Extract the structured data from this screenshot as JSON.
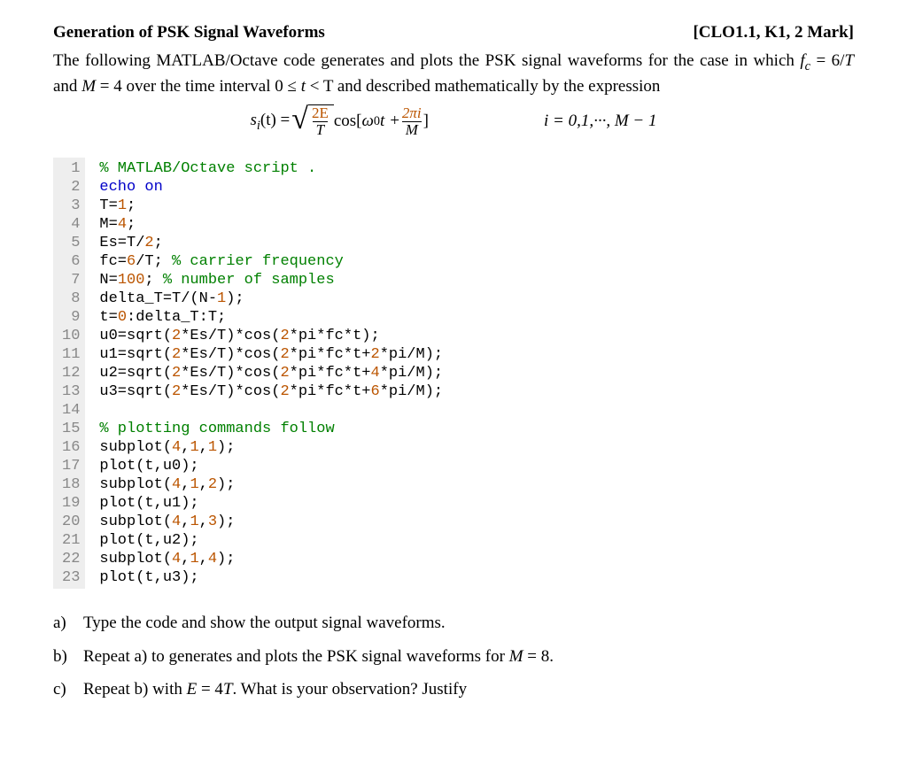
{
  "header": {
    "title": "Generation of PSK Signal Waveforms",
    "tag": "[CLO1.1, K1, 2 Mark]"
  },
  "intro": {
    "t1": "The following MATLAB/Octave code generates and plots the PSK signal waveforms for the case in which ",
    "fc": "f",
    "fc_sub": "c",
    "t2": " = 6/",
    "T": "T",
    "t3": " and ",
    "M": "M",
    "t4": " = 4 over the time interval 0 ≤ ",
    "t": "t",
    "t5": " < T and described mathematically by the expression"
  },
  "equation": {
    "lhs_s": "s",
    "lhs_i": "i",
    "lhs_of_t": "(t) = ",
    "frac_num": "2E",
    "frac_den": "T",
    "cos_open": " cos[",
    "omega": "ω",
    "omega_sub": "0",
    "omega_t": "t + ",
    "frac2_num": "2πi",
    "frac2_den": "M",
    "cos_close": "]",
    "rhs": "i = 0,1,···, M − 1"
  },
  "code": {
    "lines": [
      {
        "n": "1",
        "pre": "",
        "cmt": "% MATLAB/Octave script ."
      },
      {
        "n": "2",
        "kw": "echo on"
      },
      {
        "n": "3",
        "t1": "T=",
        "num1": "1",
        "t2": ";"
      },
      {
        "n": "4",
        "t1": "M=",
        "num1": "4",
        "t2": ";"
      },
      {
        "n": "5",
        "t1": "Es=T/",
        "num1": "2",
        "t2": ";"
      },
      {
        "n": "6",
        "t1": "fc=",
        "num1": "6",
        "t2": "/T; ",
        "cmt": "% carrier frequency"
      },
      {
        "n": "7",
        "t1": "N=",
        "num1": "100",
        "t2": "; ",
        "cmt": "% number of samples"
      },
      {
        "n": "8",
        "t1": "delta_T=T/(N-",
        "num1": "1",
        "t2": ");"
      },
      {
        "n": "9",
        "t1": "t=",
        "num1": "0",
        "t2": ":delta_T:T;"
      },
      {
        "n": "10",
        "t1": "u0=sqrt(",
        "num1": "2",
        "t2": "*Es/T)*cos(",
        "num2": "2",
        "t3": "*pi*fc*t);"
      },
      {
        "n": "11",
        "t1": "u1=sqrt(",
        "num1": "2",
        "t2": "*Es/T)*cos(",
        "num2": "2",
        "t3": "*pi*fc*t+",
        "num3": "2",
        "t4": "*pi/M);"
      },
      {
        "n": "12",
        "t1": "u2=sqrt(",
        "num1": "2",
        "t2": "*Es/T)*cos(",
        "num2": "2",
        "t3": "*pi*fc*t+",
        "num3": "4",
        "t4": "*pi/M);"
      },
      {
        "n": "13",
        "t1": "u3=sqrt(",
        "num1": "2",
        "t2": "*Es/T)*cos(",
        "num2": "2",
        "t3": "*pi*fc*t+",
        "num3": "6",
        "t4": "*pi/M);"
      },
      {
        "n": "14",
        "blank": " "
      },
      {
        "n": "15",
        "cmt": "% plotting commands follow"
      },
      {
        "n": "16",
        "t1": "subplot(",
        "num1": "4",
        "t2": ",",
        "num2": "1",
        "t3": ",",
        "num3": "1",
        "t4": ");"
      },
      {
        "n": "17",
        "t1": "plot(t,u0);"
      },
      {
        "n": "18",
        "t1": "subplot(",
        "num1": "4",
        "t2": ",",
        "num2": "1",
        "t3": ",",
        "num3": "2",
        "t4": ");"
      },
      {
        "n": "19",
        "t1": "plot(t,u1);"
      },
      {
        "n": "20",
        "t1": "subplot(",
        "num1": "4",
        "t2": ",",
        "num2": "1",
        "t3": ",",
        "num3": "3",
        "t4": ");"
      },
      {
        "n": "21",
        "t1": "plot(t,u2);"
      },
      {
        "n": "22",
        "t1": "subplot(",
        "num1": "4",
        "t2": ",",
        "num2": "1",
        "t3": ",",
        "num3": "4",
        "t4": ");"
      },
      {
        "n": "23",
        "t1": "plot(t,u3);"
      }
    ]
  },
  "questions": {
    "a_lab": "a)",
    "a_txt": "Type the code and show the output signal waveforms.",
    "b_lab": "b)",
    "b_t1": "Repeat a) to generates and plots the PSK signal waveforms for ",
    "b_M": "M",
    "b_t2": " = 8.",
    "c_lab": "c)",
    "c_t1": "Repeat b) with ",
    "c_E": "E",
    "c_eq": " = 4",
    "c_T": "T",
    "c_t2": ". What is your observation? Justify"
  }
}
